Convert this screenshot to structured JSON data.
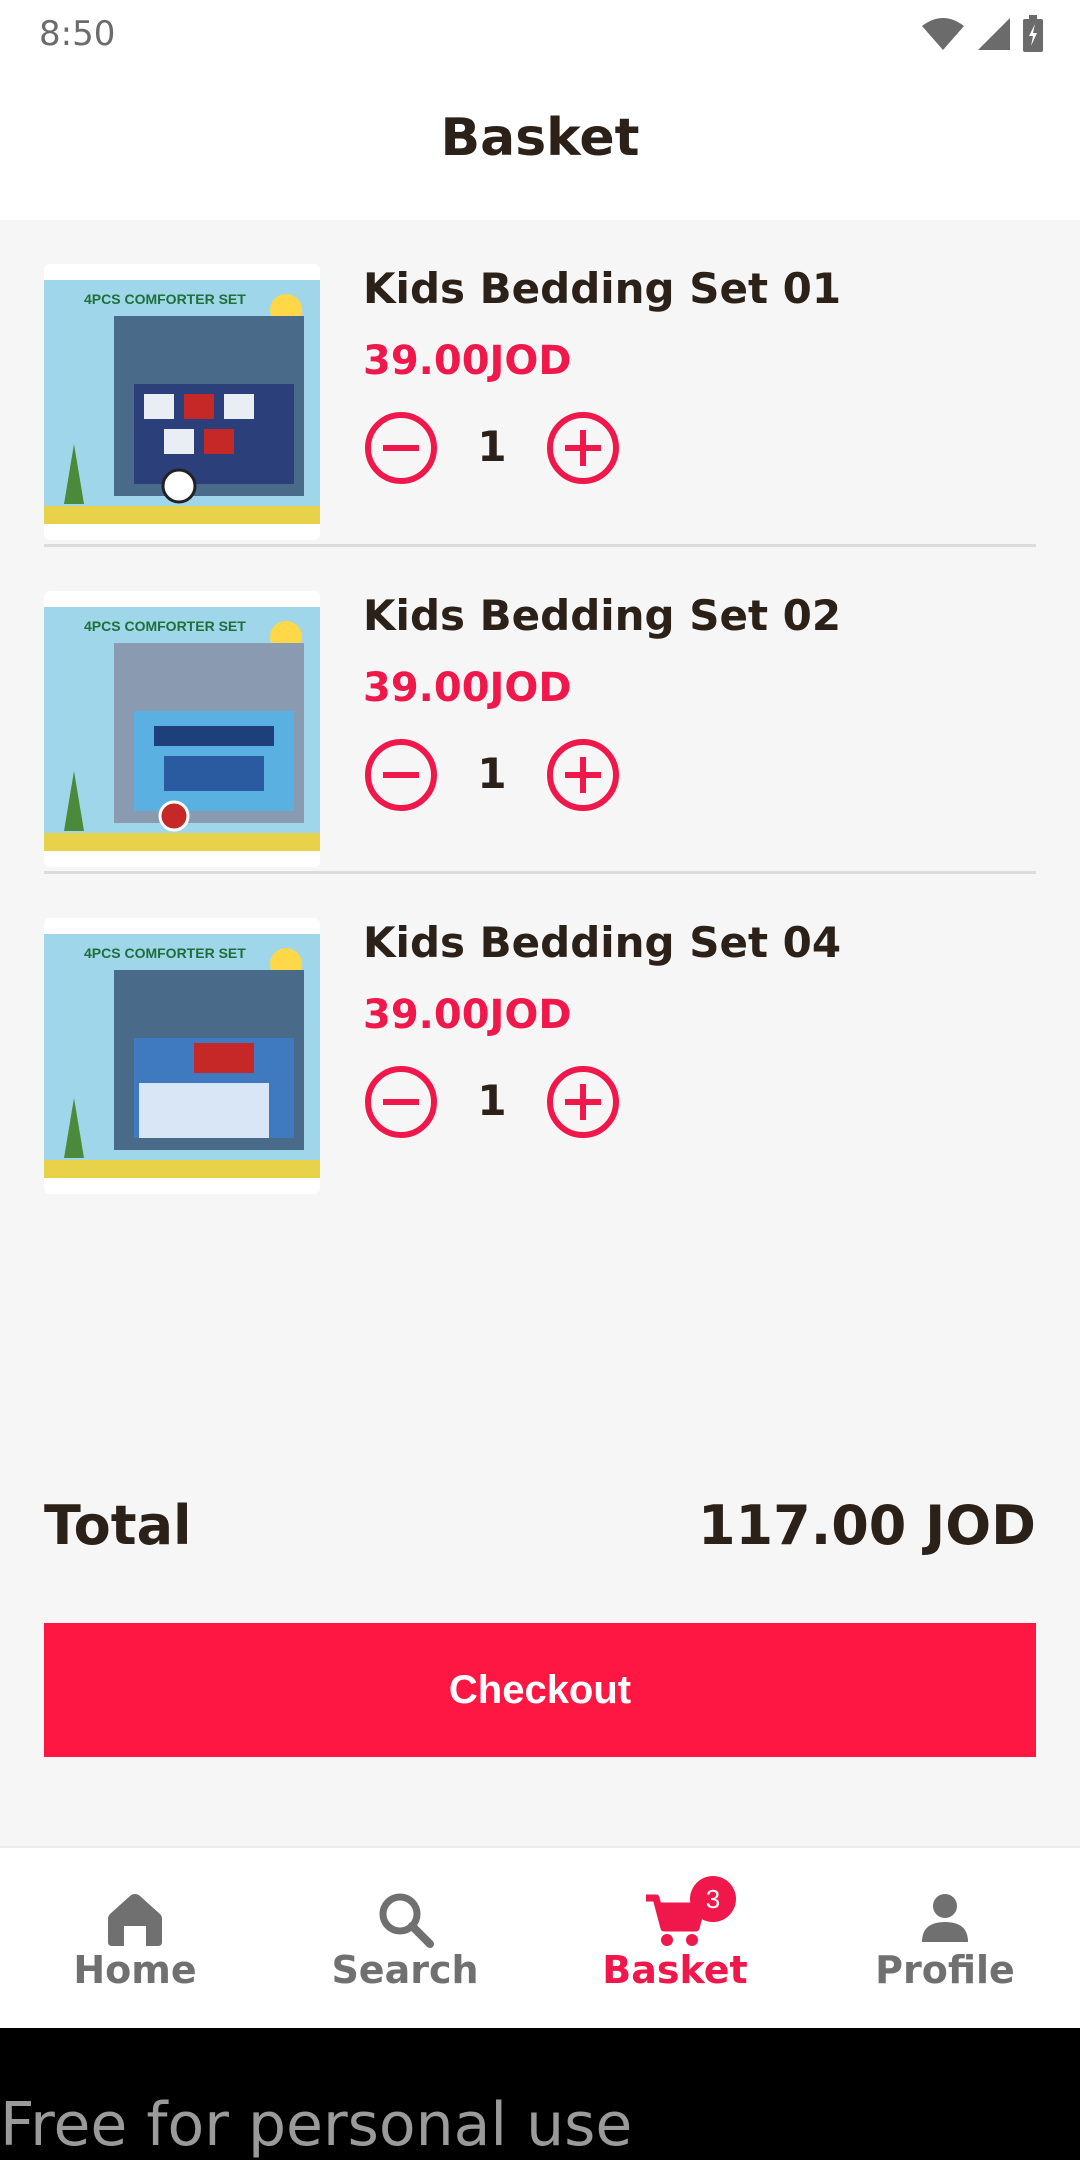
{
  "status_bar": {
    "time": "8:50",
    "icons": [
      "wifi-icon",
      "signal-icon",
      "battery-icon"
    ]
  },
  "header": {
    "title": "Basket"
  },
  "basket": {
    "items": [
      {
        "name": "Kids Bedding Set 01",
        "price": "39.00JOD",
        "quantity": "1",
        "image": "kids-bedding-set-01-image",
        "package_text": "4PCS COMFORTER SET"
      },
      {
        "name": "Kids Bedding Set 02",
        "price": "39.00JOD",
        "quantity": "1",
        "image": "kids-bedding-set-02-image",
        "package_text": "4PCS COMFORTER SET"
      },
      {
        "name": "Kids Bedding Set 04",
        "price": "39.00JOD",
        "quantity": "1",
        "image": "kids-bedding-set-04-image",
        "package_text": "4PCS COMFORTER SET"
      }
    ],
    "total_label": "Total",
    "total_value": "117.00 JOD",
    "checkout_label": "Checkout"
  },
  "bottom_nav": {
    "items": [
      {
        "label": "Home",
        "icon": "home-icon"
      },
      {
        "label": "Search",
        "icon": "search-icon"
      },
      {
        "label": "Basket",
        "icon": "cart-icon",
        "badge": "3",
        "active": true
      },
      {
        "label": "Profile",
        "icon": "profile-icon"
      }
    ]
  },
  "watermark": "Free for personal use",
  "colors": {
    "accent": "#f0174a",
    "checkout": "#ff1744",
    "text": "#2b2118",
    "muted": "#707070",
    "background": "#f6f6f6"
  }
}
